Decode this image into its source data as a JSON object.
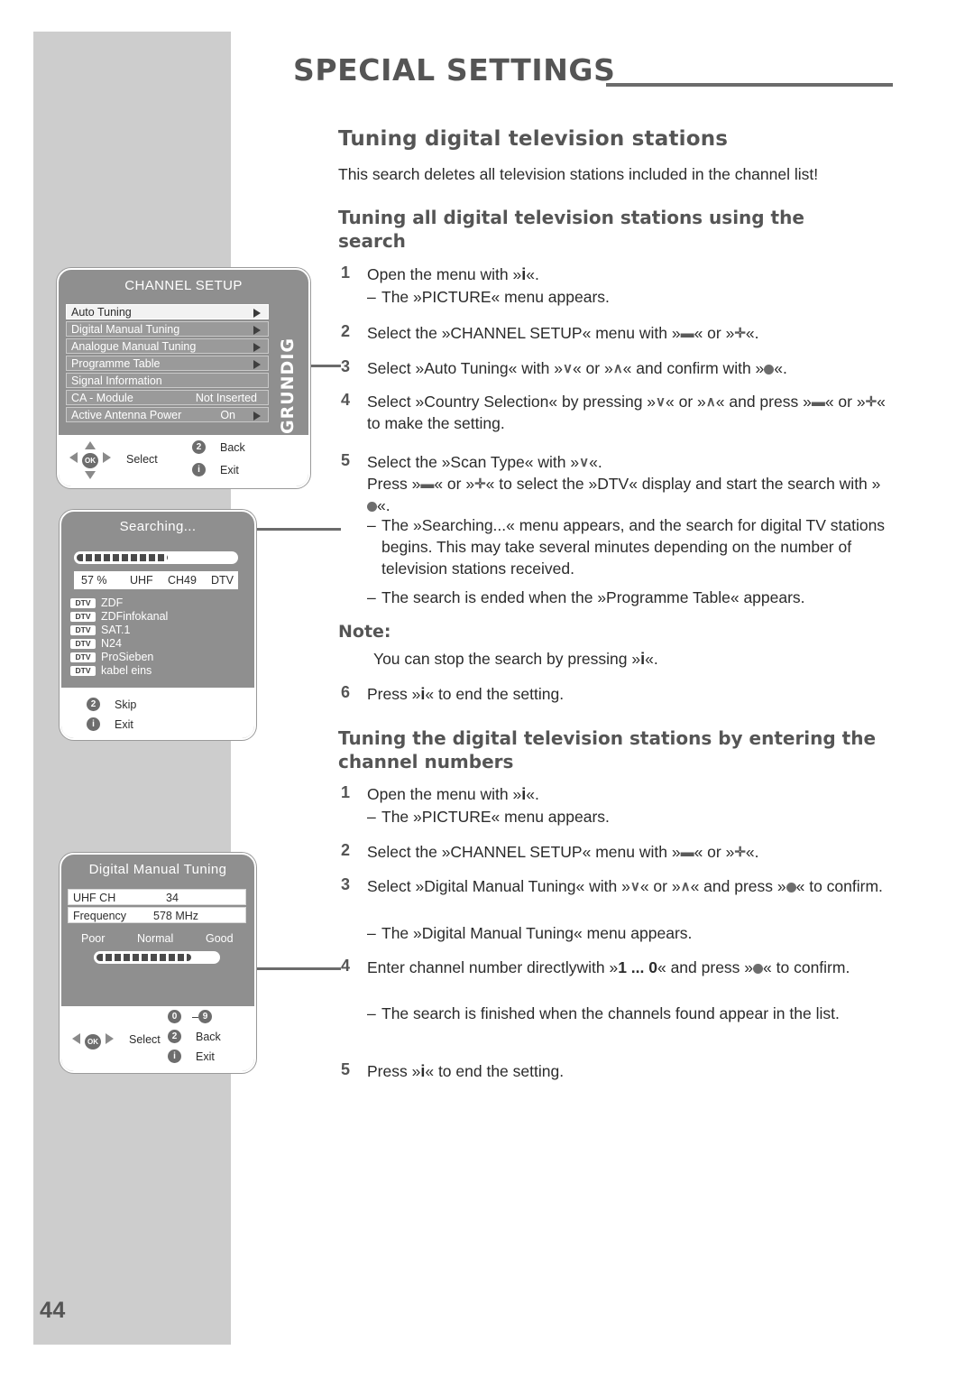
{
  "page": {
    "title": "SPECIAL SETTINGS",
    "number": "44",
    "brand": "GRUNDIG"
  },
  "content": {
    "h2": "Tuning digital television stations",
    "intro": "This search deletes all television stations included in the channel list!",
    "section1": {
      "heading": "Tuning all digital television stations using the search",
      "steps": [
        {
          "num": "1",
          "text": "Open the menu with »i«."
        },
        {
          "num": "",
          "text": "– The »PICTURE« menu appears."
        },
        {
          "num": "2",
          "text": "Select the »CHANNEL SETUP« menu with »–« or »+«."
        },
        {
          "num": "3",
          "text": "Select »Auto Tuning« with »V« or »A« and confirm with »●«."
        },
        {
          "num": "4",
          "text": "Select »Country Selection« by pressing »V« or »A« and press »–« or »+« to make the setting."
        },
        {
          "num": "5",
          "text": "Select the »Scan Type« with »V«. Press »–« or »+« to select the »DTV« display and start the search with »●«."
        },
        {
          "num": "",
          "text": "– The »Searching...« menu appears, and the search for digital TV stations begins. This may take several minutes depending on the number of television stations received."
        },
        {
          "num": "",
          "text": "– The search is ended when the »Programme Table« appears."
        }
      ],
      "note_label": "Note:",
      "note_text": "You can stop the search by pressing »i«.",
      "step6": {
        "num": "6",
        "text": "Press »i« to end the setting."
      }
    },
    "section2": {
      "heading": "Tuning the digital television stations by entering the channel numbers",
      "steps": [
        {
          "num": "1",
          "text": "Open the menu with »i«."
        },
        {
          "num": "",
          "text": "– The »PICTURE« menu appears."
        },
        {
          "num": "2",
          "text": "Select the »CHANNEL SETUP« menu with »–« or »+«."
        },
        {
          "num": "3",
          "text": "Select »Digital Manual Tuning« with »V« or »A« and press »●« to confirm."
        },
        {
          "num": "",
          "text": "– The »Digital Manual Tuning« menu appears."
        },
        {
          "num": "4",
          "text": "Enter channel number directlywith »1 ... 0« and press »●« to confirm."
        },
        {
          "num": "",
          "text": "– The search is finished when the channels found appear in the list."
        },
        {
          "num": "5",
          "text": "Press »i« to end the setting."
        }
      ]
    }
  },
  "osd_channel_setup": {
    "title": "CHANNEL SETUP",
    "rows": [
      {
        "label": "Auto Tuning",
        "value": "",
        "arrow": true,
        "selected": true
      },
      {
        "label": "Digital Manual Tuning",
        "value": "",
        "arrow": true,
        "selected": false
      },
      {
        "label": "Analogue Manual Tuning",
        "value": "",
        "arrow": true,
        "selected": false
      },
      {
        "label": "Programme Table",
        "value": "",
        "arrow": true,
        "selected": false
      },
      {
        "label": "Signal Information",
        "value": "",
        "arrow": false,
        "selected": false
      },
      {
        "label": "CA - Module",
        "value": "Not Inserted",
        "arrow": false,
        "selected": false
      },
      {
        "label": "Active Antenna Power",
        "value": "On",
        "arrow": true,
        "selected": false
      }
    ],
    "footer": {
      "dpad_label": "Select",
      "ok_label": "OK",
      "back_key": "2",
      "back_label": "Back",
      "exit_key": "i",
      "exit_label": "Exit"
    }
  },
  "osd_searching": {
    "title": "Searching...",
    "progress_percent": 57,
    "status": {
      "percent": "57 %",
      "band": "UHF",
      "channel": "CH49",
      "type": "DTV"
    },
    "channels": [
      {
        "tag": "DTV",
        "name": "ZDF"
      },
      {
        "tag": "DTV",
        "name": "ZDFinfokanal"
      },
      {
        "tag": "DTV",
        "name": "SAT.1"
      },
      {
        "tag": "DTV",
        "name": "N24"
      },
      {
        "tag": "DTV",
        "name": "ProSieben"
      },
      {
        "tag": "DTV",
        "name": "kabel eins"
      }
    ],
    "footer": {
      "skip_key": "2",
      "skip_label": "Skip",
      "exit_key": "i",
      "exit_label": "Exit"
    }
  },
  "osd_manual_tuning": {
    "title": "Digital Manual Tuning",
    "rows": [
      {
        "label": "UHF  CH",
        "value": "34"
      },
      {
        "label": "Frequency",
        "value": "578 MHz"
      }
    ],
    "quality": {
      "poor": "Poor",
      "normal": "Normal",
      "good": "Good",
      "level_percent": 78
    },
    "footer": {
      "num_from": "0",
      "num_dash": "–",
      "num_to": "9",
      "dpad_label": "Select",
      "ok_label": "OK",
      "back_key": "2",
      "back_label": "Back",
      "exit_key": "i",
      "exit_label": "Exit"
    }
  },
  "colors": {
    "sidebar": "#cdcdcd",
    "heading": "#555555",
    "body": "#2b2b2b",
    "osd_bg": "#8f8f8f",
    "osd_row": "#9a9a9a",
    "osd_row_selected": "#f2f2f2"
  }
}
